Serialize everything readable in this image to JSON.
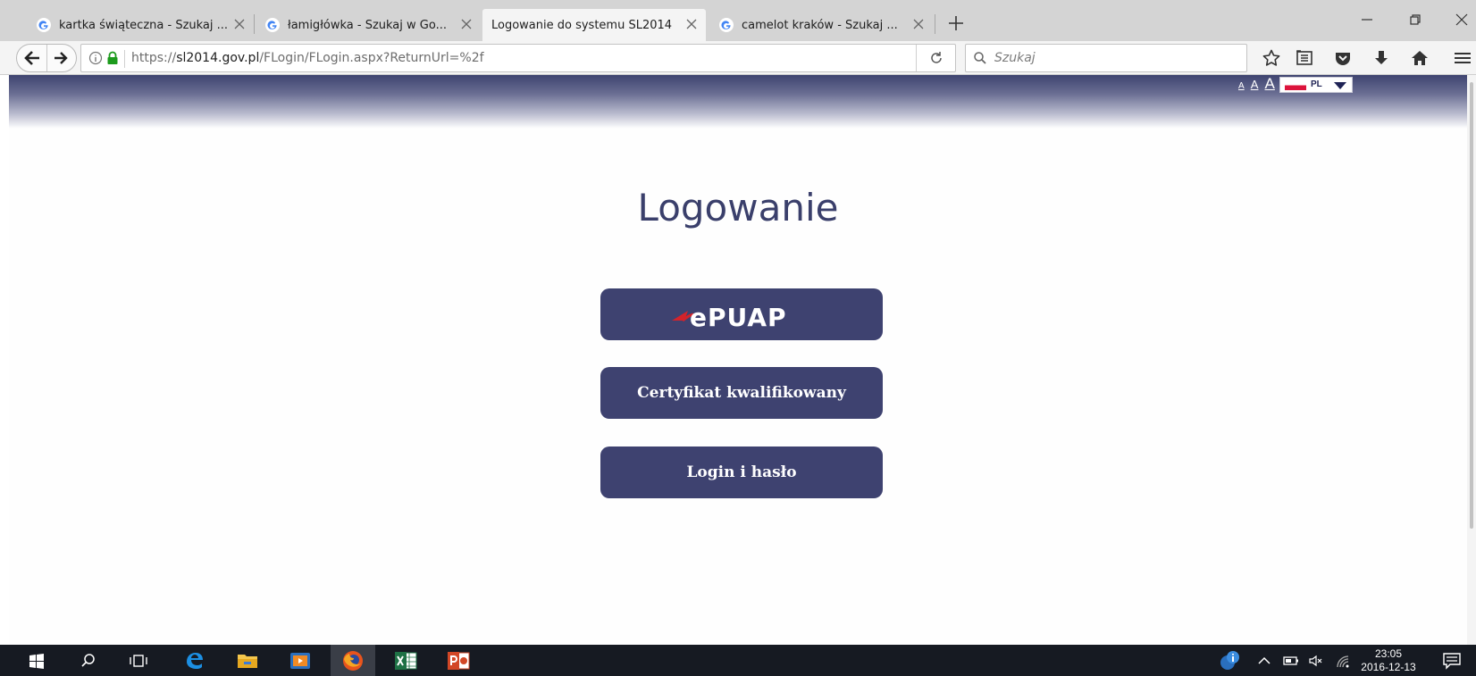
{
  "browser": {
    "tabs": [
      {
        "title": "kartka świąteczna - Szukaj ...",
        "favicon": "google-icon",
        "active": false
      },
      {
        "title": "łamigłówka - Szukaj w Go...",
        "favicon": "google-icon",
        "active": false
      },
      {
        "title": "Logowanie do systemu SL2014",
        "favicon": "none",
        "active": true
      },
      {
        "title": "camelot kraków - Szukaj ...",
        "favicon": "google-icon",
        "active": false
      }
    ],
    "url_prefix": "https://",
    "url_domain": "sl2014.gov.pl",
    "url_path": "/FLogin/FLogin.aspx?ReturnUrl=%2f",
    "search_placeholder": "Szukaj",
    "toolbar_icons": [
      "bookmark-star-icon",
      "reader-view-icon",
      "pocket-icon",
      "downloads-icon",
      "home-icon",
      "menu-icon"
    ]
  },
  "page": {
    "font_size_controls": [
      "A",
      "A",
      "A"
    ],
    "language": {
      "code": "PL",
      "flag": "poland-flag"
    },
    "title": "Logowanie",
    "buttons": {
      "epuap_label": "ePUAP",
      "certificate_label": "Certyfikat kwalifikowany",
      "login_password_label": "Login i hasło"
    },
    "colors": {
      "accent": "#3e4270",
      "header_dark": "#3f4470",
      "title_text": "#3a3f6b"
    }
  },
  "taskbar": {
    "apps": [
      "windows-start-icon",
      "search-icon",
      "task-view-icon",
      "edge-icon",
      "file-explorer-icon",
      "media-player-icon",
      "firefox-icon",
      "excel-icon",
      "powerpoint-icon"
    ],
    "tray": [
      "update-info-icon",
      "chevron-up-icon",
      "battery-icon",
      "volume-muted-icon",
      "wifi-icon"
    ],
    "time": "23:05",
    "date": "2016-12-13"
  }
}
